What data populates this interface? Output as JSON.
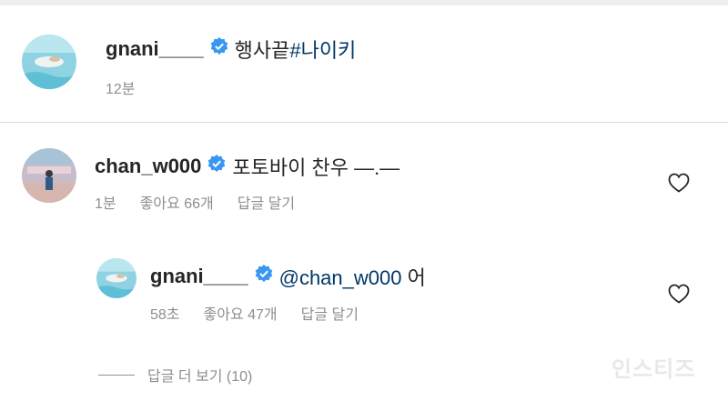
{
  "caption": {
    "username": "gnani____",
    "text": "행사끝",
    "hashtag": "#나이키",
    "time": "12분"
  },
  "comments": [
    {
      "username": "chan_w000",
      "text": "포토바이 찬우 —.—",
      "time": "1분",
      "likes": "좋아요 66개",
      "reply_label": "답글 달기"
    }
  ],
  "reply": {
    "username": "gnani____",
    "mention": "@chan_w000",
    "text": "어",
    "time": "58초",
    "likes": "좋아요 47개",
    "reply_label": "답글 달기"
  },
  "view_more": "답글 더 보기 (10)",
  "watermark": "인스티즈",
  "icons": {
    "verified": "verified-badge-icon",
    "like": "heart-outline-icon"
  },
  "colors": {
    "verified": "#3897f0",
    "link": "#00376b",
    "meta_text": "#8e8e8e"
  }
}
